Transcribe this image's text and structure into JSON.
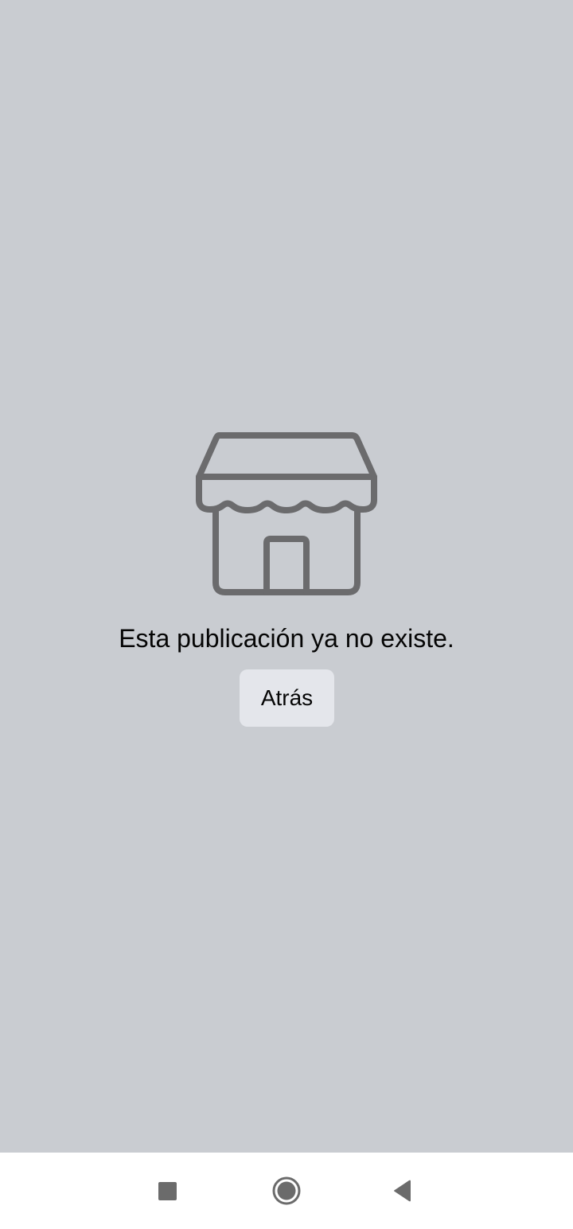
{
  "screen": {
    "background_color": "#c9ccd1",
    "icon": "store-icon",
    "icon_color": "#6b6b6d",
    "message": "Esta publicación ya no existe.",
    "back_button_label": "Atrás"
  },
  "system_nav": {
    "background_color": "#ffffff",
    "buttons": [
      "recents-icon",
      "home-icon",
      "back-icon"
    ]
  }
}
